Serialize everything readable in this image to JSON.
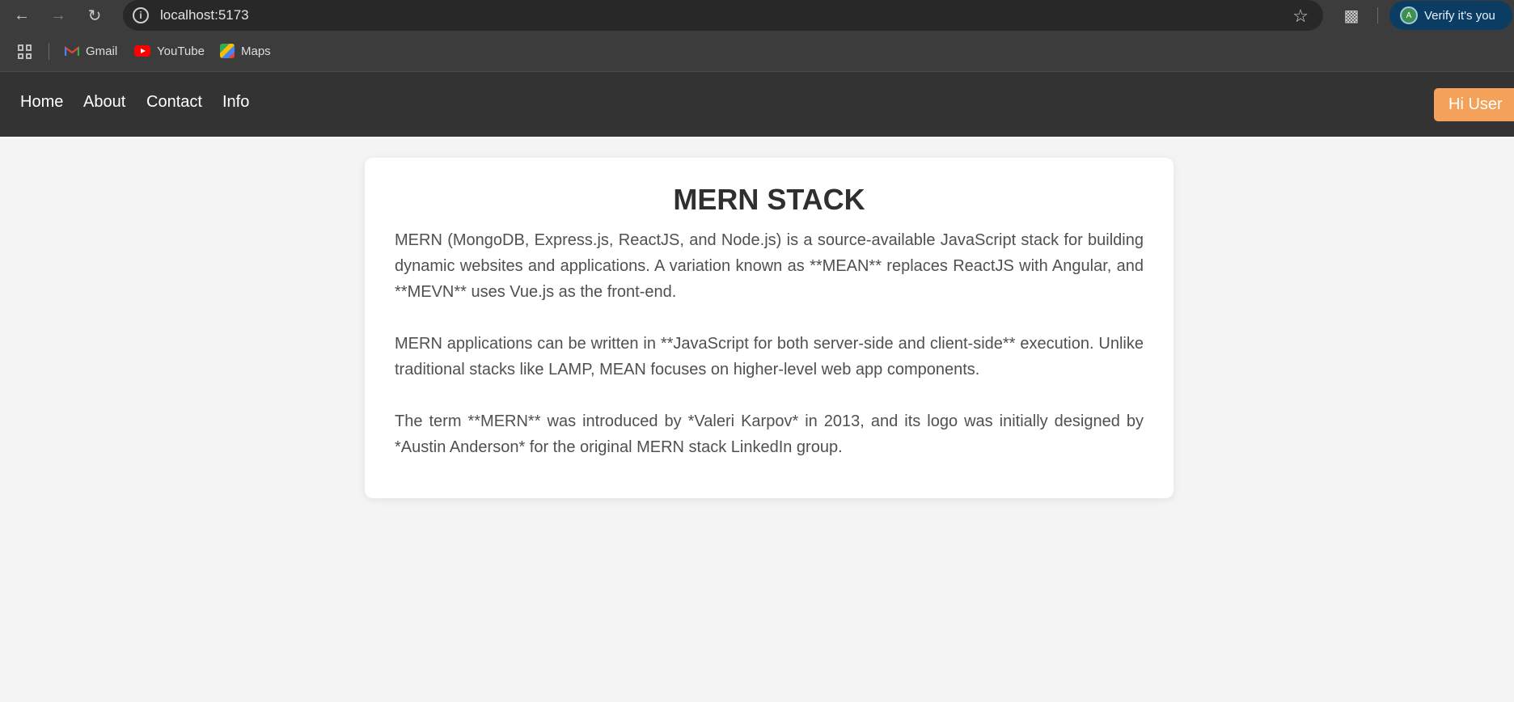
{
  "browser": {
    "url": "localhost:5173",
    "profile_button": "Verify it's you",
    "profile_initial": "A",
    "bookmarks": [
      {
        "label": "Gmail",
        "icon": "gmail-icon"
      },
      {
        "label": "YouTube",
        "icon": "youtube-icon"
      },
      {
        "label": "Maps",
        "icon": "maps-icon"
      }
    ]
  },
  "nav": {
    "links": [
      "Home",
      "About",
      "Contact",
      "Info"
    ],
    "user_button": "Hi User",
    "bg_color": "#333333",
    "user_button_color": "#f4a259"
  },
  "card": {
    "title": "MERN STACK",
    "paragraphs": [
      "MERN (MongoDB, Express.js, ReactJS, and Node.js) is a source-available JavaScript stack for building dynamic websites and applications. A variation known as **MEAN** replaces ReactJS with Angular, and **MEVN** uses Vue.js as the front-end.",
      "MERN applications can be written in **JavaScript for both server-side and client-side** execution. Unlike traditional stacks like LAMP, MEAN focuses on higher-level web app components.",
      "The term **MERN** was introduced by *Valeri Karpov* in 2013, and its logo was initially designed by *Austin Anderson* for the original MERN stack LinkedIn group."
    ]
  }
}
